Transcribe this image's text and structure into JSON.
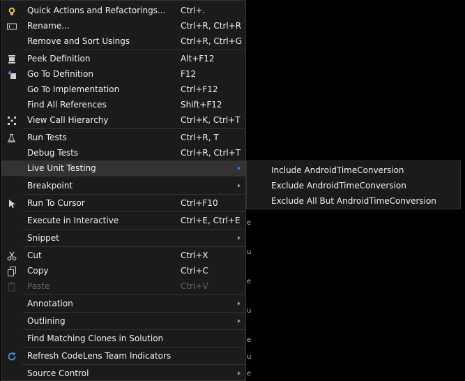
{
  "menu": {
    "items": [
      {
        "label": "Quick Actions and Refactorings...",
        "shortcut": "Ctrl+.",
        "icon": "lightbulb-icon"
      },
      {
        "label": "Rename...",
        "shortcut": "Ctrl+R, Ctrl+R",
        "icon": "rename-icon"
      },
      {
        "label": "Remove and Sort Usings",
        "shortcut": "Ctrl+R, Ctrl+G"
      },
      {
        "label": "Peek Definition",
        "shortcut": "Alt+F12",
        "icon": "peek-definition-icon"
      },
      {
        "label": "Go To Definition",
        "shortcut": "F12",
        "icon": "go-to-definition-icon"
      },
      {
        "label": "Go To Implementation",
        "shortcut": "Ctrl+F12"
      },
      {
        "label": "Find All References",
        "shortcut": "Shift+F12"
      },
      {
        "label": "View Call Hierarchy",
        "shortcut": "Ctrl+K, Ctrl+T",
        "icon": "call-hierarchy-icon"
      },
      {
        "label": "Run Tests",
        "shortcut": "Ctrl+R, T",
        "icon": "flask-icon"
      },
      {
        "label": "Debug Tests",
        "shortcut": "Ctrl+R, Ctrl+T"
      },
      {
        "label": "Live Unit Testing",
        "shortcut": "",
        "submenu": true,
        "highlighted": true
      },
      {
        "label": "Breakpoint",
        "shortcut": "",
        "submenu": true
      },
      {
        "label": "Run To Cursor",
        "shortcut": "Ctrl+F10",
        "icon": "cursor-icon"
      },
      {
        "label": "Execute in Interactive",
        "shortcut": "Ctrl+E, Ctrl+E"
      },
      {
        "label": "Snippet",
        "shortcut": "",
        "submenu": true
      },
      {
        "label": "Cut",
        "shortcut": "Ctrl+X",
        "icon": "scissors-icon"
      },
      {
        "label": "Copy",
        "shortcut": "Ctrl+C",
        "icon": "copy-icon"
      },
      {
        "label": "Paste",
        "shortcut": "Ctrl+V",
        "icon": "paste-icon",
        "disabled": true
      },
      {
        "label": "Annotation",
        "shortcut": "",
        "submenu": true
      },
      {
        "label": "Outlining",
        "shortcut": "",
        "submenu": true
      },
      {
        "label": "Find Matching Clones in Solution",
        "shortcut": ""
      },
      {
        "label": "Refresh CodeLens Team Indicators",
        "shortcut": "",
        "icon": "refresh-icon"
      },
      {
        "label": "Source Control",
        "shortcut": "",
        "submenu": true
      }
    ]
  },
  "submenu": {
    "items": [
      {
        "label": "Include AndroidTimeConversion"
      },
      {
        "label": "Exclude AndroidTimeConversion"
      },
      {
        "label": "Exclude All But AndroidTimeConversion"
      }
    ]
  },
  "editor": {
    "glyphs": [
      "e",
      "u",
      "e",
      "u",
      "e",
      "u",
      "e"
    ]
  },
  "colors": {
    "menu_bg": "#1b1b1c",
    "highlight_bg": "#333334",
    "separator": "#333337",
    "text": "#f1f1f1",
    "disabled_text": "#656565",
    "accent": "#3d8be0"
  }
}
